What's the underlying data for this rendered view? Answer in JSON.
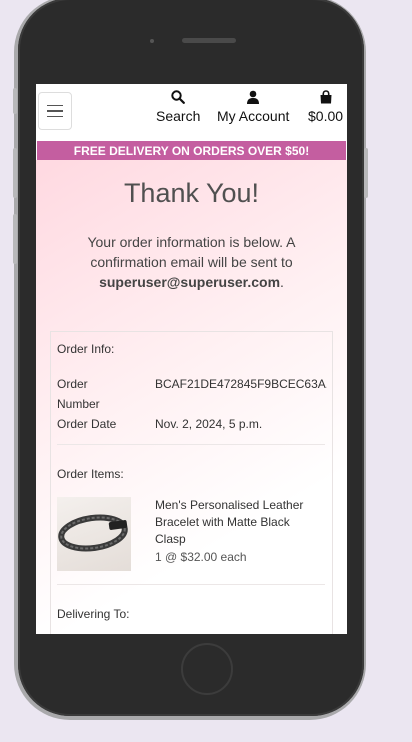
{
  "header": {
    "search_label": "Search",
    "account_label": "My Account",
    "bag_total": "$0.00"
  },
  "promo": {
    "text": "FREE DELIVERY ON ORDERS OVER $50!"
  },
  "confirmation": {
    "title": "Thank You!",
    "message": "Your order information is below. A confirmation email will be sent to",
    "email": "superuser@superuser.com",
    "period": "."
  },
  "order_info": {
    "heading": "Order Info:",
    "number_label_line1": "Order",
    "number_label_line2": "Number",
    "number_value": "BCAF21DE472845F9BCEC63A...",
    "date_label": "Order Date",
    "date_value": "Nov. 2, 2024, 5 p.m."
  },
  "order_items": {
    "heading": "Order Items:",
    "items": [
      {
        "name_line1": "Men's Personalised Leather",
        "name_line2": "Bracelet with Matte Black",
        "name_line3": "Clasp",
        "qty_price": "1 @ $32.00 each"
      }
    ]
  },
  "delivery": {
    "heading": "Delivering To:"
  },
  "colors": {
    "promo_bg": "#c45ea0",
    "page_bg": "#ebe6f1"
  }
}
